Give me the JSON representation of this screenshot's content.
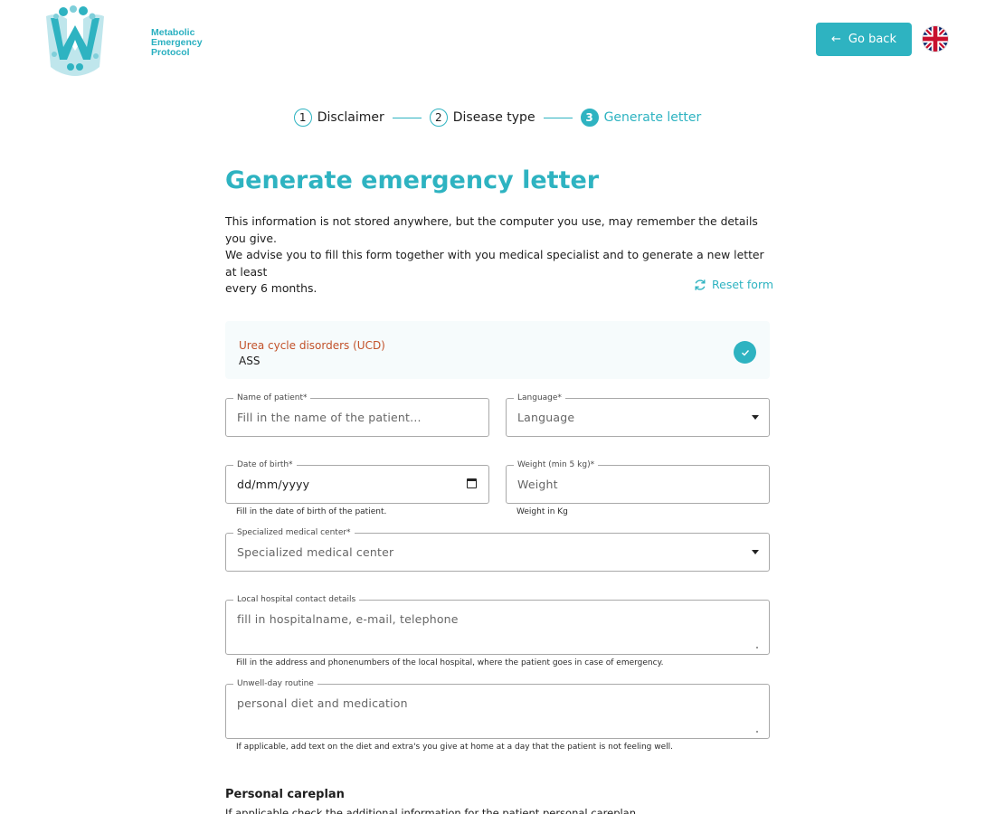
{
  "brand": {
    "logo_text_line1": "Metabolic",
    "logo_text_line2": "Emergency",
    "logo_text_line3": "Protocol",
    "accent_color": "#2eb3c1"
  },
  "header": {
    "go_back_label": "Go back",
    "language_flag": "uk-flag-icon"
  },
  "stepper": {
    "steps": [
      {
        "number": "1",
        "label": "Disclaimer"
      },
      {
        "number": "2",
        "label": "Disease type"
      },
      {
        "number": "3",
        "label": "Generate letter"
      }
    ]
  },
  "page": {
    "title": "Generate emergency letter",
    "intro_line1": "This information is not stored anywhere, but the computer you use, may remember the details you give.",
    "intro_line2": "We advise you to fill this form together with you medical specialist and to generate a new letter at least",
    "intro_line3": "every 6 months.",
    "reset_label": "Reset form"
  },
  "disease": {
    "category": "Urea cycle disorders (UCD)",
    "name": "ASS"
  },
  "form": {
    "name": {
      "label": "Name of patient*",
      "placeholder": "Fill in the name of the patient..."
    },
    "language": {
      "label": "Language*",
      "value": "Language"
    },
    "dob": {
      "label": "Date of birth*",
      "value": "dd/mm/yyyy",
      "hint": "Fill in the date of birth of the patient."
    },
    "weight": {
      "label": "Weight (min 5 kg)*",
      "placeholder": "Weight",
      "hint": "Weight in Kg"
    },
    "center": {
      "label": "Specialized medical center*",
      "value": "Specialized medical center"
    },
    "hospital": {
      "label": "Local hospital contact details",
      "placeholder": "fill in hospitalname, e-mail, telephone",
      "hint": "Fill in the address and phonenumbers of the local hospital, where the patient goes in case of emergency."
    },
    "routine": {
      "label": "Unwell-day routine",
      "placeholder": "personal diet and medication",
      "hint": "If applicable, add text on the diet and extra's you give at home at a day that the patient is not feeling well."
    }
  },
  "careplan": {
    "title": "Personal careplan",
    "subtitle": "If applicable check the additional information for the patient personal careplan"
  }
}
